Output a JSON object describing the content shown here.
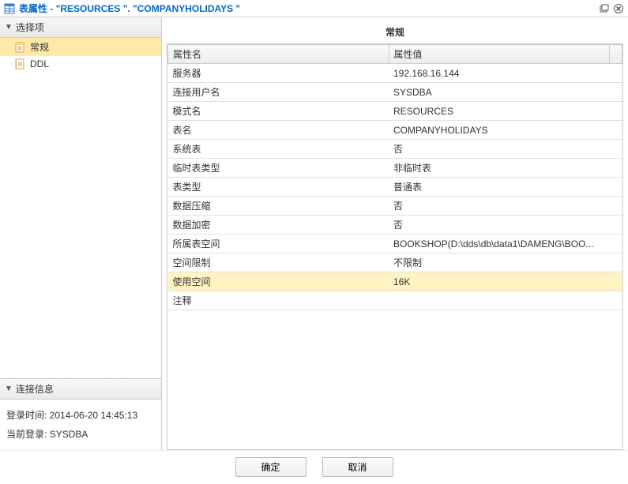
{
  "window": {
    "title": "表属性  -   \"RESOURCES \". \"COMPANYHOLIDAYS \""
  },
  "sidebar": {
    "options_header": "选择项",
    "items": [
      {
        "label": "常规",
        "icon": "sheet-icon"
      },
      {
        "label": "DDL",
        "icon": "script-icon"
      }
    ],
    "conn_header": "连接信息",
    "login_time_label": "登录时间:",
    "login_time_value": "2014-06-20 14:45:13",
    "current_login_label": "当前登录:",
    "current_login_value": "SYSDBA"
  },
  "content": {
    "title": "常规",
    "columns": {
      "name": "属性名",
      "value": "属性值"
    },
    "rows": [
      {
        "name": "服务器",
        "value": "192.168.16.144"
      },
      {
        "name": "连接用户名",
        "value": "SYSDBA"
      },
      {
        "name": "模式名",
        "value": "RESOURCES"
      },
      {
        "name": "表名",
        "value": "COMPANYHOLIDAYS"
      },
      {
        "name": "系统表",
        "value": "否"
      },
      {
        "name": "临时表类型",
        "value": "非临时表"
      },
      {
        "name": "表类型",
        "value": "普通表"
      },
      {
        "name": "数据压缩",
        "value": "否"
      },
      {
        "name": "数据加密",
        "value": "否"
      },
      {
        "name": "所属表空间",
        "value": "BOOKSHOP(D:\\dds\\db\\data1\\DAMENG\\BOO..."
      },
      {
        "name": "空间限制",
        "value": "不限制"
      },
      {
        "name": "使用空间",
        "value": "16K",
        "highlight": true
      },
      {
        "name": "注释",
        "value": ""
      }
    ]
  },
  "buttons": {
    "ok": "确定",
    "cancel": "取消"
  }
}
